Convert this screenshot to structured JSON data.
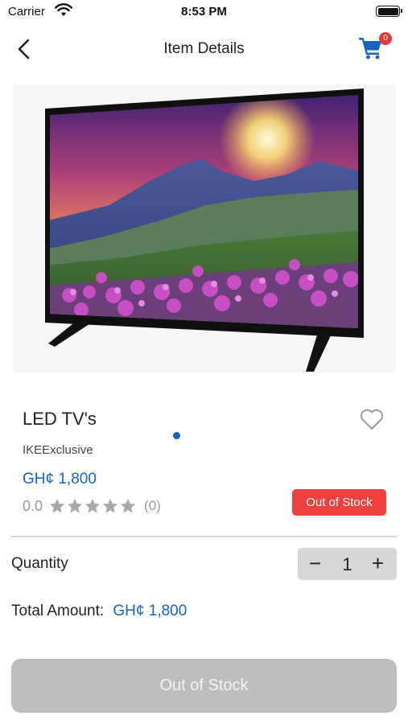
{
  "status_bar": {
    "carrier": "Carrier",
    "time": "8:53 PM"
  },
  "nav": {
    "title": "Item Details",
    "cart_count": "0",
    "back_icon": "chevron-left-icon",
    "cart_icon": "cart-icon"
  },
  "product": {
    "name": "LED TV's",
    "seller": "IKEExclusive",
    "price": "GH¢ 1,800",
    "rating_value": "0.0",
    "rating_count": "(0)",
    "stars_filled": 0,
    "stars_total": 5,
    "stock_status": "Out of Stock",
    "carousel_dots": 1,
    "carousel_active": 0
  },
  "quantity": {
    "label": "Quantity",
    "value": "1",
    "minus": "−",
    "plus": "+"
  },
  "total": {
    "label": "Total Amount:",
    "value": "GH¢ 1,800"
  },
  "action_button": {
    "label": "Out of Stock"
  },
  "colors": {
    "accent": "#1565c0",
    "badge_red": "#ef4040",
    "disabled_button": "#bcbdbf",
    "star_grey": "#a8a8a8"
  }
}
